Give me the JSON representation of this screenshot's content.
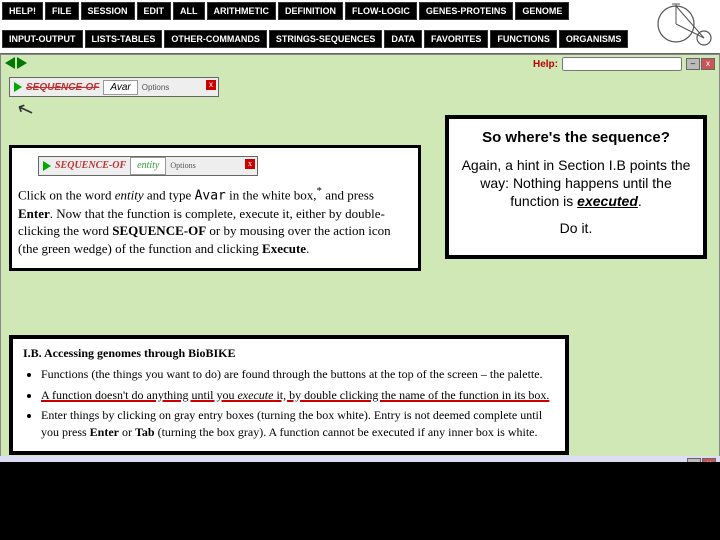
{
  "menu": {
    "row1": [
      "HELP!",
      "FILE",
      "SESSION",
      "EDIT",
      "ALL",
      "ARITHMETIC",
      "DEFINITION",
      "FLOW-LOGIC",
      "GENES-PROTEINS",
      "GENOME"
    ],
    "row2": [
      "INPUT-OUTPUT",
      "LISTS-TABLES",
      "OTHER-COMMANDS",
      "STRINGS-SEQUENCES",
      "DATA",
      "FAVORITES",
      "FUNCTIONS",
      "ORGANISMS"
    ]
  },
  "help_label": "Help:",
  "seq": {
    "label": "SEQUENCE-OF",
    "avar": "Avar",
    "entity": "entity",
    "options": "Options"
  },
  "instruct": {
    "p1_a": "Click on the word ",
    "p1_entity": "entity",
    "p1_b": " and type ",
    "p1_avar": "Avar",
    "p1_c": " in the white box,",
    "p1_d": " and press ",
    "p1_enter": "Enter",
    "p1_e": ". Now that the function is complete, execute it, either by double-clicking the word ",
    "p1_seq": "SEQUENCE-OF",
    "p1_f": " or by mousing over the action icon (the green wedge) of the function and clicking ",
    "p1_exec": "Execute",
    "p1_g": "."
  },
  "callout": {
    "title": "So where's the sequence?",
    "p1": "Again, a hint in Section I.B points the way: Nothing happens until the function is ",
    "p1_exec": "executed",
    "p1_end": ".",
    "p2": "Do it."
  },
  "ib": {
    "title": "I.B. Accessing genomes through BioBIKE",
    "b1": "Functions (the things you want to do) are found through the buttons at the top of the screen – the palette.",
    "b2a": "A function doesn't do anything until you ",
    "b2_exec": "execute",
    "b2b": " it, by double clicking the name of the function in its box.",
    "b3a": "Enter things by clicking on gray entry boxes (turning the box white). Entry is not deemed complete until you press ",
    "b3_enter": "Enter",
    "b3b": " or ",
    "b3_tab": "Tab",
    "b3c": " (turning the box gray). A function cannot be executed if any inner box is white."
  },
  "icons": {
    "min": "–",
    "close": "x"
  }
}
